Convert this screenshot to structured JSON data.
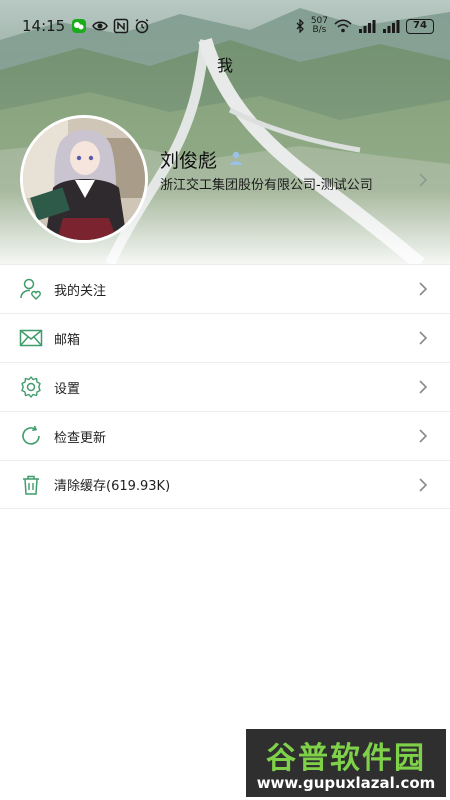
{
  "status_bar": {
    "time": "14:15",
    "net_speed_value": "507",
    "net_speed_unit": "B/s",
    "battery": "74"
  },
  "page_title": "我",
  "profile": {
    "name": "刘俊彪",
    "company": "浙江交工集团股份有限公司-测试公司"
  },
  "menu": [
    {
      "label": "我的关注",
      "icon": "user-heart-icon"
    },
    {
      "label": "邮箱",
      "icon": "mail-icon"
    },
    {
      "label": "设置",
      "icon": "gear-icon"
    },
    {
      "label": "检查更新",
      "icon": "refresh-icon"
    },
    {
      "label": "清除缓存(619.93K)",
      "icon": "trash-icon"
    }
  ],
  "watermark": {
    "title": "谷普软件园",
    "url": "www.gupuxlazal.com"
  },
  "colors": {
    "accent": "#3f9d6b",
    "divider": "#ececec",
    "chevron": "#8a8a8a"
  }
}
